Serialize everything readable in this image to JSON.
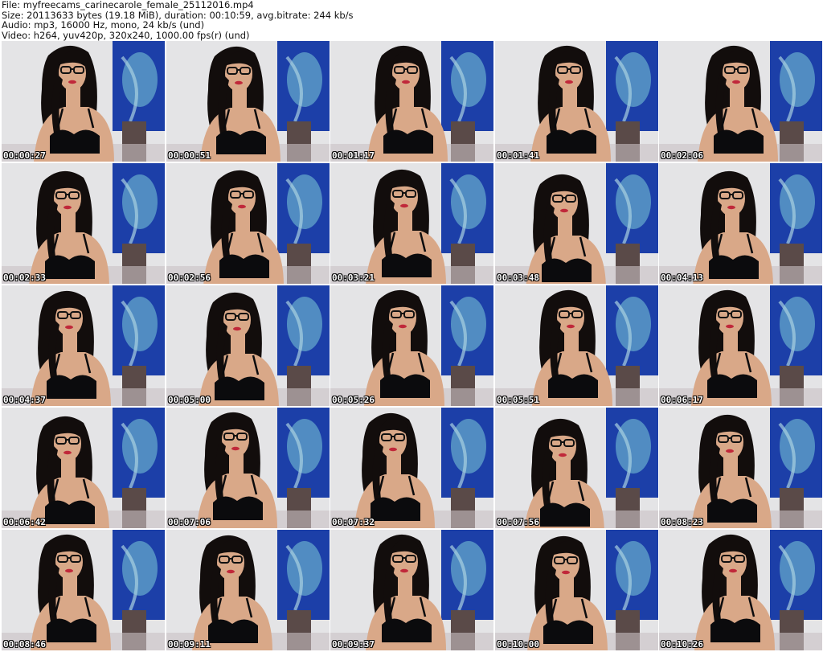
{
  "header": {
    "file_line": "File: myfreecams_carinecarole_female_25112016.mp4",
    "size_line": "Size: 20113633 bytes (19.18 MiB), duration: 00:10:59, avg.bitrate: 244 kb/s",
    "audio_line": "Audio: mp3, 16000 Hz, mono, 24 kb/s (und)",
    "video_line": "Video: h264, yuv420p, 320x240, 1000.00 fps(r) (und)"
  },
  "colors": {
    "wall": "#e4e4e6",
    "painting": "#1c3fa8",
    "painting_light": "#5fa0c8",
    "hair": "#120d0c",
    "skin": "#d9a888",
    "bra": "#0b0b0d",
    "timestamp": "#ffffff"
  },
  "thumbnails": [
    {
      "timestamp": "00:00:27"
    },
    {
      "timestamp": "00:00:51"
    },
    {
      "timestamp": "00:01:17"
    },
    {
      "timestamp": "00:01:41"
    },
    {
      "timestamp": "00:02:06"
    },
    {
      "timestamp": "00:02:33"
    },
    {
      "timestamp": "00:02:56"
    },
    {
      "timestamp": "00:03:21"
    },
    {
      "timestamp": "00:03:48"
    },
    {
      "timestamp": "00:04:13"
    },
    {
      "timestamp": "00:04:37"
    },
    {
      "timestamp": "00:05:00"
    },
    {
      "timestamp": "00:05:26"
    },
    {
      "timestamp": "00:05:51"
    },
    {
      "timestamp": "00:06:17"
    },
    {
      "timestamp": "00:06:42"
    },
    {
      "timestamp": "00:07:06"
    },
    {
      "timestamp": "00:07:32"
    },
    {
      "timestamp": "00:07:56"
    },
    {
      "timestamp": "00:08:23"
    },
    {
      "timestamp": "00:08:46"
    },
    {
      "timestamp": "00:09:11"
    },
    {
      "timestamp": "00:09:37"
    },
    {
      "timestamp": "00:10:00"
    },
    {
      "timestamp": "00:10:26"
    }
  ]
}
